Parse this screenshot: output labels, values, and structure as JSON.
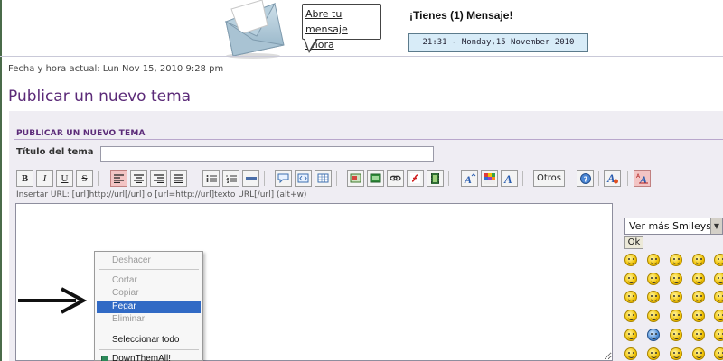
{
  "header": {
    "bubble_line1": "Abre tu",
    "bubble_line2": "mensaje ahora",
    "messages_title": "¡Tienes (1) Mensaje!",
    "clock": "21:31 - Monday,15 November 2010"
  },
  "datetime": "Fecha y hora actual: Lun Nov 15, 2010 9:28 pm",
  "page_title": "Publicar un nuevo tema",
  "form": {
    "heading": "PUBLICAR UN NUEVO TEMA",
    "subject_label": "Título del tema",
    "subject_value": "",
    "url_hint": "Insertar URL: [url]http://url[/url] o [url=http://url]texto URL[/url] (alt+w)"
  },
  "toolbar": {
    "bold": "B",
    "italic": "I",
    "underline": "U",
    "strike": "S",
    "others_label": "Otros",
    "icons": [
      "bold-icon",
      "italic-icon",
      "underline-icon",
      "strikethrough-icon",
      "align-left-icon",
      "align-center-icon",
      "align-right-icon",
      "align-justify-icon",
      "bulleted-list-icon",
      "numbered-list-icon",
      "horizontal-rule-icon",
      "quote-icon",
      "code-icon",
      "table-icon",
      "image-icon",
      "image-upload-icon",
      "link-icon",
      "flash-icon",
      "video-icon",
      "font-size-icon",
      "color-icon",
      "font-face-icon",
      "help-icon",
      "hide-icon",
      "mode-switch-icon"
    ]
  },
  "context_menu": {
    "items": [
      {
        "label": "Deshacer",
        "enabled": false
      },
      {
        "label": "Cortar",
        "enabled": false
      },
      {
        "label": "Copiar",
        "enabled": false
      },
      {
        "label": "Pegar",
        "enabled": true,
        "selected": true
      },
      {
        "label": "Eliminar",
        "enabled": false
      },
      {
        "label": "Seleccionar todo",
        "enabled": true
      },
      {
        "label": "DownThemAll!",
        "enabled": true
      }
    ]
  },
  "smileys": {
    "select_value": "Ver más Smileys",
    "ok_label": "Ok"
  },
  "colors": {
    "title_purple": "#5b2a78",
    "panel_bg": "#efedf3",
    "clock_bg": "#d8ecf8",
    "menu_highlight": "#316ac5"
  }
}
